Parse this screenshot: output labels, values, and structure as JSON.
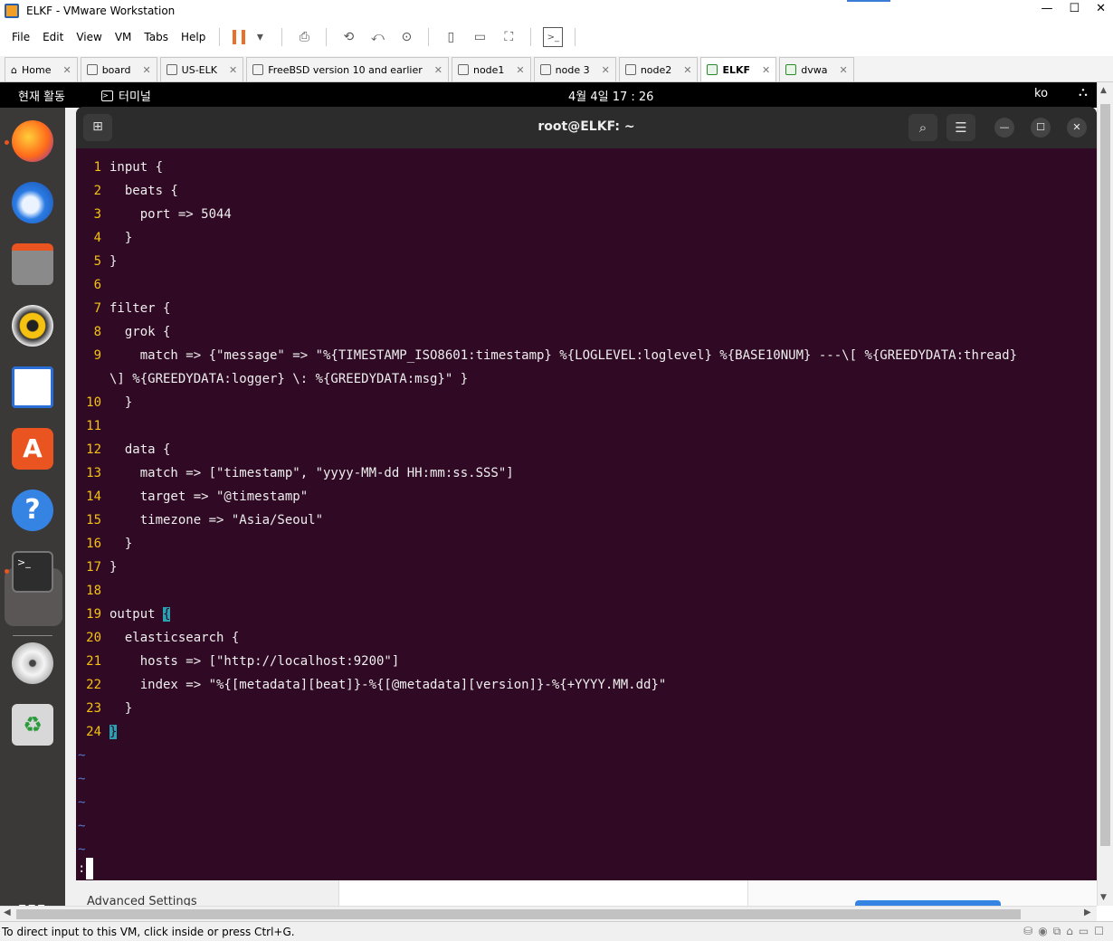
{
  "window": {
    "title": "ELKF - VMware Workstation"
  },
  "menu": [
    "File",
    "Edit",
    "View",
    "VM",
    "Tabs",
    "Help"
  ],
  "tabs": [
    {
      "label": "Home",
      "active": false,
      "icon": "home-icon"
    },
    {
      "label": "board",
      "active": false,
      "icon": "vm-icon"
    },
    {
      "label": "US-ELK",
      "active": false,
      "icon": "vm-icon"
    },
    {
      "label": "FreeBSD version 10 and earlier",
      "active": false,
      "icon": "vm-icon"
    },
    {
      "label": "node1",
      "active": false,
      "icon": "vm-icon"
    },
    {
      "label": "node 3",
      "active": false,
      "icon": "vm-icon"
    },
    {
      "label": "node2",
      "active": false,
      "icon": "vm-icon"
    },
    {
      "label": "ELKF",
      "active": true,
      "icon": "vm-running-icon"
    },
    {
      "label": "dvwa",
      "active": false,
      "icon": "vm-running-icon"
    }
  ],
  "gnome": {
    "activities": "현재 활동",
    "app_name": "터미널",
    "clock": "4월 4일  17 : 26",
    "lang": "ko"
  },
  "dock_items": [
    "firefox-icon",
    "thunderbird-icon",
    "files-icon",
    "rhythmbox-icon",
    "writer-icon",
    "app-center-icon",
    "help-icon",
    "terminal-icon",
    "dvd-icon",
    "trash-icon"
  ],
  "bg_window": {
    "advanced_settings": "Advanced Settings"
  },
  "terminal": {
    "title": "root@ELKF: ~",
    "lines": [
      {
        "n": "1",
        "t": "input {"
      },
      {
        "n": "2",
        "t": "  beats {"
      },
      {
        "n": "3",
        "t": "    port => 5044"
      },
      {
        "n": "4",
        "t": "  }"
      },
      {
        "n": "5",
        "t": "}"
      },
      {
        "n": "6",
        "t": ""
      },
      {
        "n": "7",
        "t": "filter {"
      },
      {
        "n": "8",
        "t": "  grok {"
      },
      {
        "n": "9",
        "t": "    match => {\"message\" => \"%{TIMESTAMP_ISO8601:timestamp} %{LOGLEVEL:loglevel} %{BASE10NUM} ---\\[ %{GREEDYDATA:thread}"
      },
      {
        "n": "",
        "t": "\\] %{GREEDYDATA:logger} \\: %{GREEDYDATA:msg}\" }"
      },
      {
        "n": "10",
        "t": "  }"
      },
      {
        "n": "11",
        "t": ""
      },
      {
        "n": "12",
        "t": "  data {"
      },
      {
        "n": "13",
        "t": "    match => [\"timestamp\", \"yyyy-MM-dd HH:mm:ss.SSS\"]"
      },
      {
        "n": "14",
        "t": "    target => \"@timestamp\""
      },
      {
        "n": "15",
        "t": "    timezone => \"Asia/Seoul\""
      },
      {
        "n": "16",
        "t": "  }"
      },
      {
        "n": "17",
        "t": "}"
      },
      {
        "n": "18",
        "t": ""
      },
      {
        "n": "19",
        "t": "output ",
        "hl": "{"
      },
      {
        "n": "20",
        "t": "  elasticsearch {"
      },
      {
        "n": "21",
        "t": "    hosts => [\"http://localhost:9200\"]"
      },
      {
        "n": "22",
        "t": "    index => \"%{[metadata][beat]}-%{[@metadata][version]}-%{+YYYY.MM.dd}\""
      },
      {
        "n": "23",
        "t": "  }"
      },
      {
        "n": "24",
        "t": "",
        "hl": "}"
      }
    ],
    "tildes": [
      "~",
      "~",
      "~",
      "~",
      "~"
    ],
    "cmdline": ":"
  },
  "status": {
    "message": "To direct input to this VM, click inside or press Ctrl+G."
  }
}
